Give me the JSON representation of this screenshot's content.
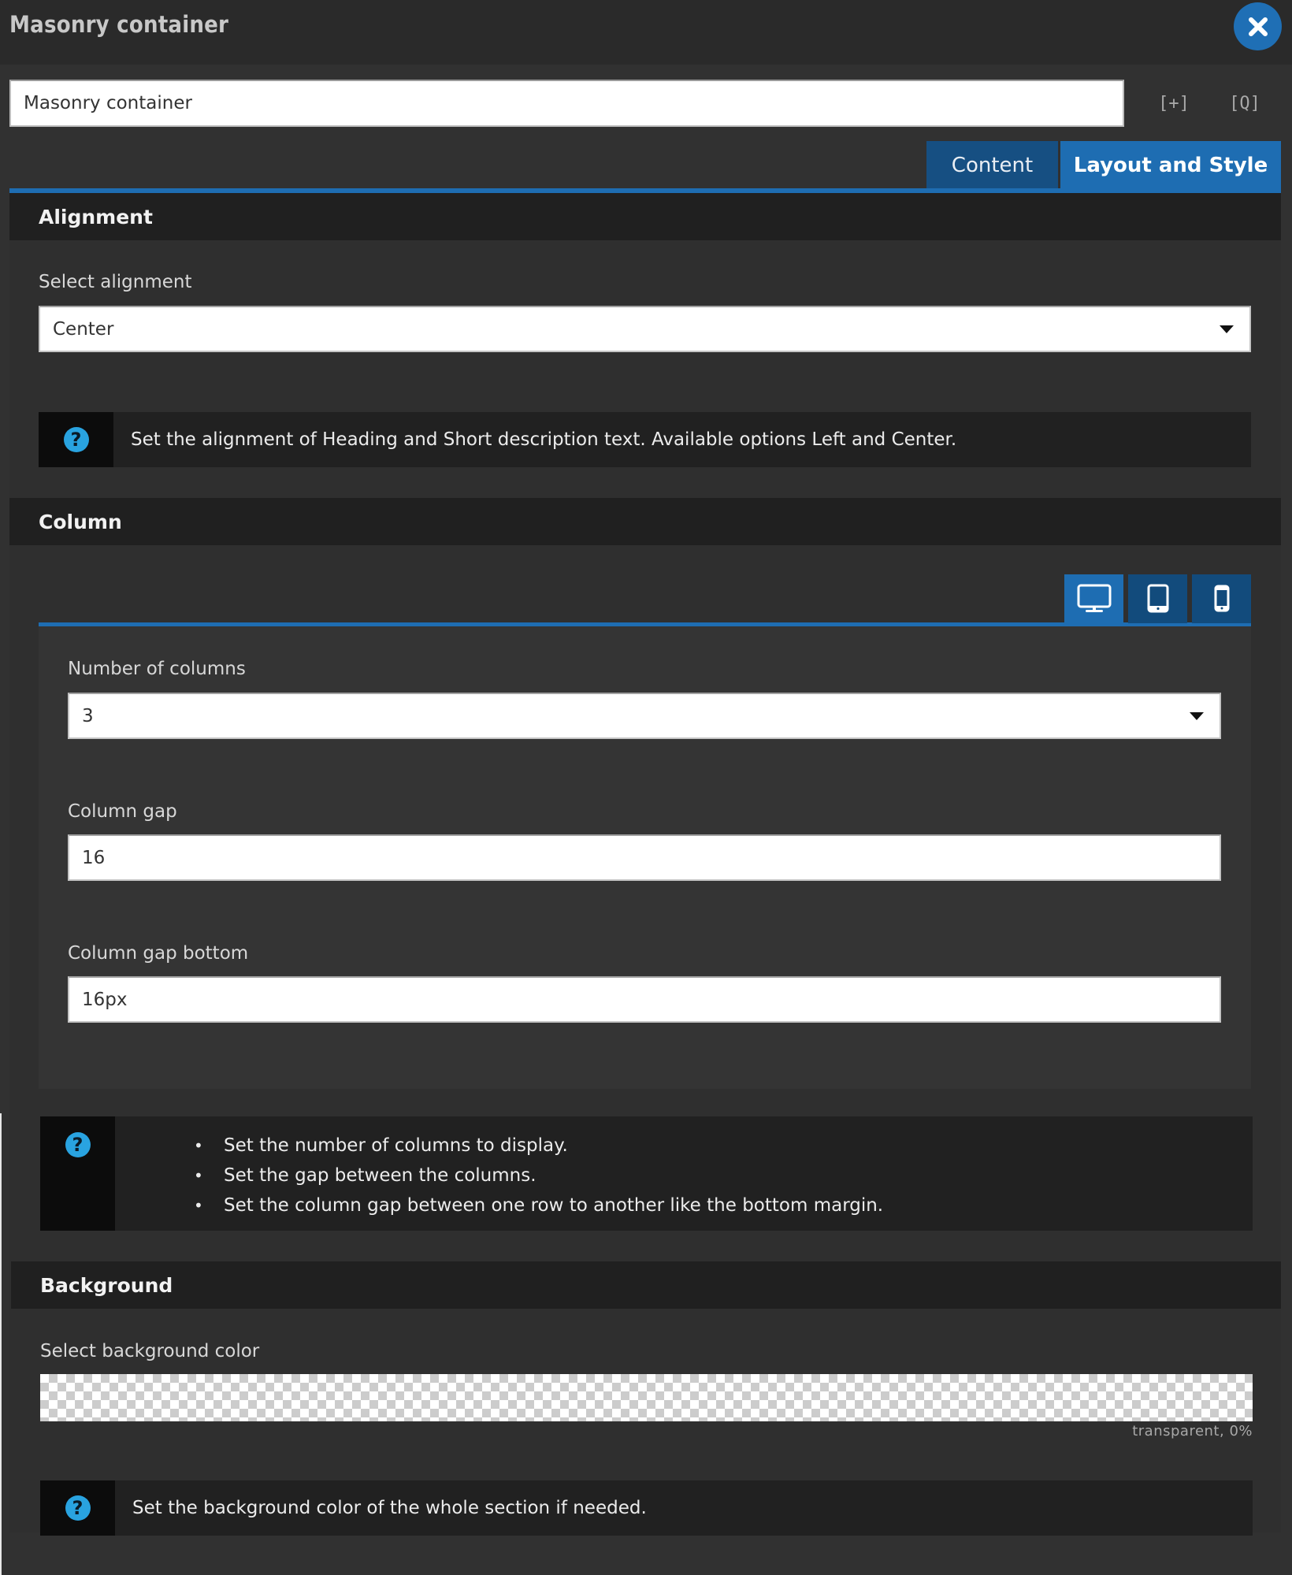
{
  "header": {
    "title": "Masonry container",
    "close_icon": "close-icon"
  },
  "title_field": {
    "value": "Masonry container",
    "icons": [
      "expand-icon",
      "preview-icon"
    ],
    "icon_glyphs": [
      "[+]",
      "[Q]"
    ]
  },
  "tabs": [
    {
      "label": "Content",
      "active": false
    },
    {
      "label": "Layout and Style",
      "active": true
    }
  ],
  "colors": {
    "accent": "#1e6db2",
    "accent_dark": "#164f82",
    "help_icon": "#29a3e0",
    "section_header_bg": "#202020",
    "panel_bg": "#2f2f2f"
  },
  "sections": {
    "alignment": {
      "title": "Alignment",
      "select_label": "Select alignment",
      "select_value": "Center",
      "help": "Set the alignment of Heading and Short description text. Available options Left and Center."
    },
    "column": {
      "title": "Column",
      "devices": [
        {
          "name": "desktop",
          "icon": "desktop-icon",
          "active": true
        },
        {
          "name": "tablet",
          "icon": "tablet-icon",
          "active": false
        },
        {
          "name": "mobile",
          "icon": "mobile-icon",
          "active": false
        }
      ],
      "number_of_columns_label": "Number of columns",
      "number_of_columns_value": "3",
      "column_gap_label": "Column gap",
      "column_gap_value": "16",
      "column_gap_bottom_label": "Column gap bottom",
      "column_gap_bottom_value": "16px",
      "help_items": [
        "Set the number of columns to display.",
        "Set the gap between the columns.",
        "Set the column gap between one row to another like the bottom margin."
      ]
    },
    "background": {
      "title": "Background",
      "color_label": "Select background color",
      "color_caption": "transparent, 0%",
      "help": "Set the background color of the whole section if needed."
    }
  }
}
